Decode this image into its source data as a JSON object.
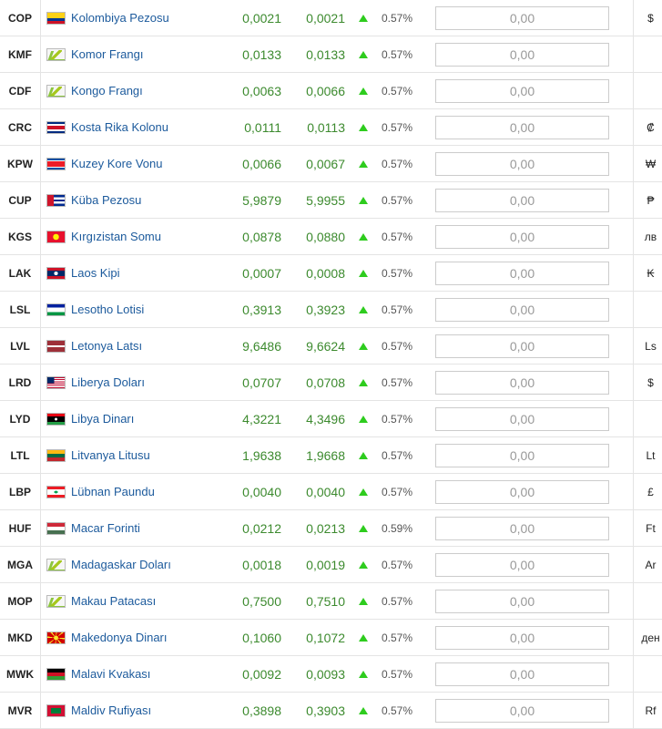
{
  "rows": [
    {
      "code": "COP",
      "name": "Kolombiya Pezosu",
      "buy": "0,0021",
      "sell": "0,0021",
      "pct": "0.57%",
      "placeholder": "0,00",
      "symbol": "$",
      "flag": "colombia-flag-icon"
    },
    {
      "code": "KMF",
      "name": "Komor Frangı",
      "buy": "0,0133",
      "sell": "0,0133",
      "pct": "0.57%",
      "placeholder": "0,00",
      "symbol": "",
      "flag": "generic-currency-icon"
    },
    {
      "code": "CDF",
      "name": "Kongo Frangı",
      "buy": "0,0063",
      "sell": "0,0066",
      "pct": "0.57%",
      "placeholder": "0,00",
      "symbol": "",
      "flag": "generic-currency-icon"
    },
    {
      "code": "CRC",
      "name": "Kosta Rika Kolonu",
      "buy": "0,0111",
      "sell": "0,0113",
      "pct": "0.57%",
      "placeholder": "0,00",
      "symbol": "₡",
      "flag": "costa-rica-flag-icon"
    },
    {
      "code": "KPW",
      "name": "Kuzey Kore Vonu",
      "buy": "0,0066",
      "sell": "0,0067",
      "pct": "0.57%",
      "placeholder": "0,00",
      "symbol": "₩",
      "flag": "north-korea-flag-icon"
    },
    {
      "code": "CUP",
      "name": "Küba Pezosu",
      "buy": "5,9879",
      "sell": "5,9955",
      "pct": "0.57%",
      "placeholder": "0,00",
      "symbol": "₱",
      "flag": "cuba-flag-icon"
    },
    {
      "code": "KGS",
      "name": "Kırgızistan Somu",
      "buy": "0,0878",
      "sell": "0,0880",
      "pct": "0.57%",
      "placeholder": "0,00",
      "symbol": "лв",
      "flag": "kyrgyzstan-flag-icon"
    },
    {
      "code": "LAK",
      "name": "Laos Kipi",
      "buy": "0,0007",
      "sell": "0,0008",
      "pct": "0.57%",
      "placeholder": "0,00",
      "symbol": "₭",
      "flag": "laos-flag-icon"
    },
    {
      "code": "LSL",
      "name": "Lesotho Lotisi",
      "buy": "0,3913",
      "sell": "0,3923",
      "pct": "0.57%",
      "placeholder": "0,00",
      "symbol": "",
      "flag": "lesotho-flag-icon"
    },
    {
      "code": "LVL",
      "name": "Letonya Latsı",
      "buy": "9,6486",
      "sell": "9,6624",
      "pct": "0.57%",
      "placeholder": "0,00",
      "symbol": "Ls",
      "flag": "latvia-flag-icon"
    },
    {
      "code": "LRD",
      "name": "Liberya Doları",
      "buy": "0,0707",
      "sell": "0,0708",
      "pct": "0.57%",
      "placeholder": "0,00",
      "symbol": "$",
      "flag": "liberia-flag-icon"
    },
    {
      "code": "LYD",
      "name": "Libya Dinarı",
      "buy": "4,3221",
      "sell": "4,3496",
      "pct": "0.57%",
      "placeholder": "0,00",
      "symbol": "",
      "flag": "libya-flag-icon"
    },
    {
      "code": "LTL",
      "name": "Litvanya Litusu",
      "buy": "1,9638",
      "sell": "1,9668",
      "pct": "0.57%",
      "placeholder": "0,00",
      "symbol": "Lt",
      "flag": "lithuania-flag-icon"
    },
    {
      "code": "LBP",
      "name": "Lübnan Paundu",
      "buy": "0,0040",
      "sell": "0,0040",
      "pct": "0.57%",
      "placeholder": "0,00",
      "symbol": "£",
      "flag": "lebanon-flag-icon"
    },
    {
      "code": "HUF",
      "name": "Macar Forinti",
      "buy": "0,0212",
      "sell": "0,0213",
      "pct": "0.59%",
      "placeholder": "0,00",
      "symbol": "Ft",
      "flag": "hungary-flag-icon"
    },
    {
      "code": "MGA",
      "name": "Madagaskar Doları",
      "buy": "0,0018",
      "sell": "0,0019",
      "pct": "0.57%",
      "placeholder": "0,00",
      "symbol": "Ar",
      "flag": "generic-currency-icon"
    },
    {
      "code": "MOP",
      "name": "Makau Patacası",
      "buy": "0,7500",
      "sell": "0,7510",
      "pct": "0.57%",
      "placeholder": "0,00",
      "symbol": "",
      "flag": "generic-currency-icon"
    },
    {
      "code": "MKD",
      "name": "Makedonya Dinarı",
      "buy": "0,1060",
      "sell": "0,1072",
      "pct": "0.57%",
      "placeholder": "0,00",
      "symbol": "ден",
      "flag": "macedonia-flag-icon"
    },
    {
      "code": "MWK",
      "name": "Malavi Kvakası",
      "buy": "0,0092",
      "sell": "0,0093",
      "pct": "0.57%",
      "placeholder": "0,00",
      "symbol": "",
      "flag": "malawi-flag-icon"
    },
    {
      "code": "MVR",
      "name": "Maldiv Rufiyası",
      "buy": "0,3898",
      "sell": "0,3903",
      "pct": "0.57%",
      "placeholder": "0,00",
      "symbol": "Rf",
      "flag": "maldives-flag-icon"
    }
  ],
  "colors": {
    "link": "#1c5a9c",
    "price": "#3c8a2e",
    "up_arrow": "#2ecc1e",
    "border": "#e4e4e4"
  }
}
